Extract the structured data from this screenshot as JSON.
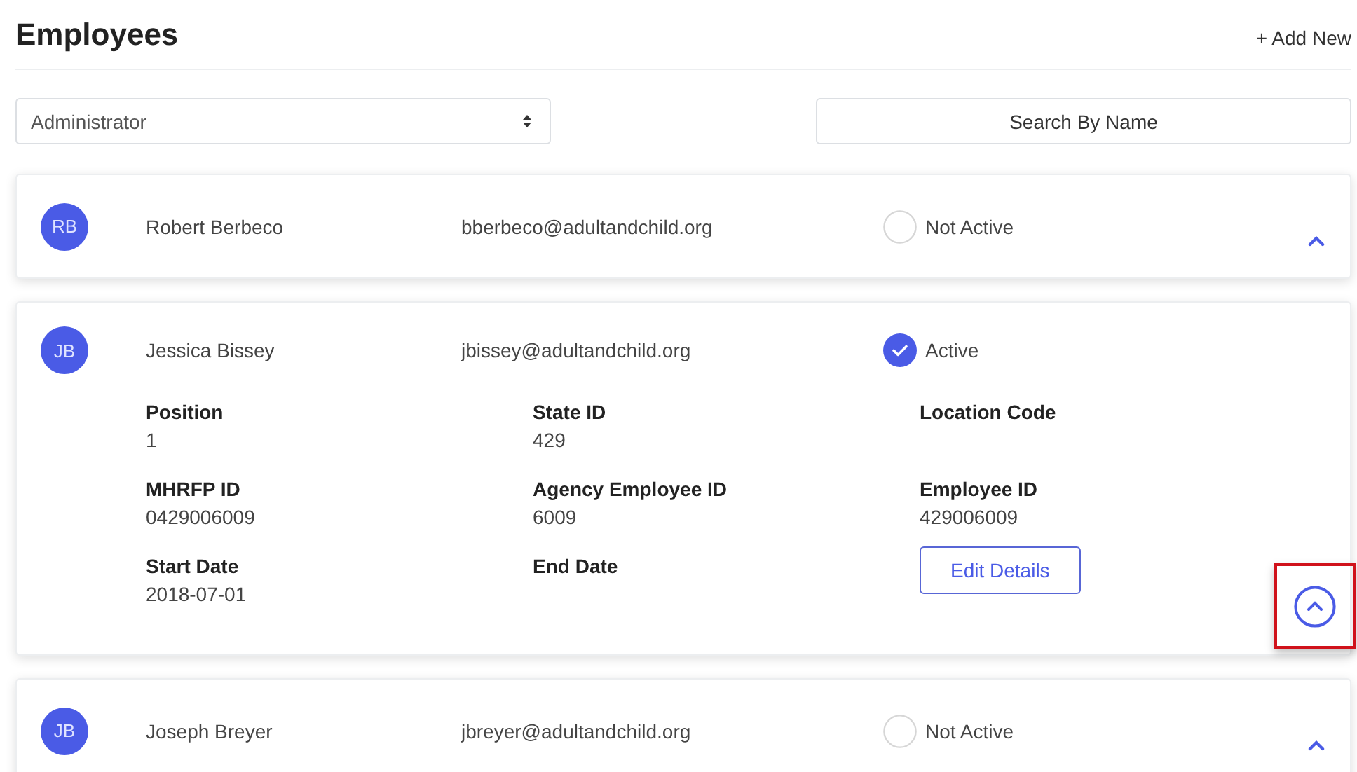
{
  "page": {
    "title": "Employees",
    "add_button": "+ Add New"
  },
  "filters": {
    "role_select": {
      "value": "Administrator"
    },
    "search": {
      "placeholder": "Search By Name"
    }
  },
  "employees": [
    {
      "initials": "RB",
      "name": "Robert Berbeco",
      "email": "bberbeco@adultandchild.org",
      "active": false,
      "status": "Not Active",
      "expanded": false
    },
    {
      "initials": "JB",
      "name": "Jessica Bissey",
      "email": "jbissey@adultandchild.org",
      "active": true,
      "status": "Active",
      "expanded": true,
      "toggle_highlighted": true,
      "details": [
        {
          "label": "Position",
          "value": "1"
        },
        {
          "label": "State ID",
          "value": "429"
        },
        {
          "label": "Location Code"
        },
        {
          "label": "MHRFP ID",
          "value": "0429006009"
        },
        {
          "label": "Agency Employee ID",
          "value": "6009"
        },
        {
          "label": "Employee ID",
          "value": "429006009"
        },
        {
          "label": "Start Date",
          "value": "2018-07-01"
        },
        {
          "label": "End Date"
        }
      ],
      "edit_button": "Edit Details"
    },
    {
      "initials": "JB",
      "name": "Joseph Breyer",
      "email": "jbreyer@adultandchild.org",
      "active": false,
      "status": "Not Active",
      "expanded": false
    }
  ]
}
